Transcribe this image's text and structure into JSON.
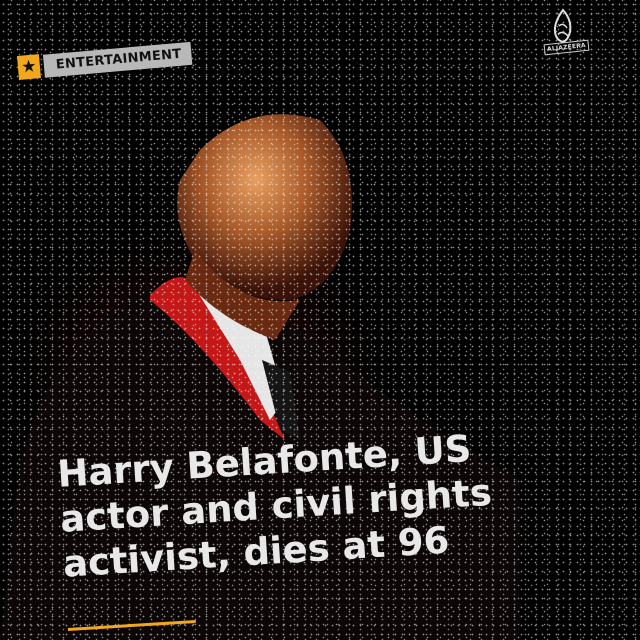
{
  "brand": {
    "name": "ALJAZEERA",
    "accent": "#f2a81d"
  },
  "category": {
    "label": "ENTERTAINMENT",
    "icon": "star-icon"
  },
  "headline": "Harry Belafonte, US actor and civil rights activist, dies at 96"
}
